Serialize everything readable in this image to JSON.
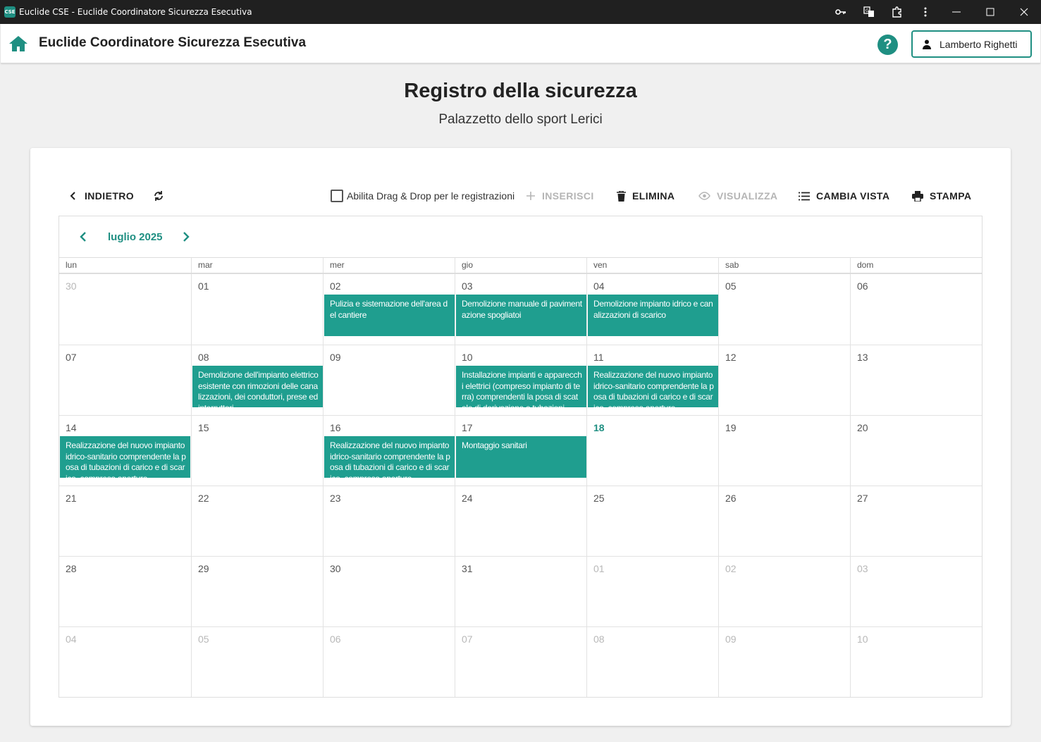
{
  "window": {
    "title": "Euclide CSE - Euclide Coordinatore Sicurezza Esecutiva",
    "logo_text": "CSE"
  },
  "appbar": {
    "title": "Euclide Coordinatore Sicurezza Esecutiva",
    "help_label": "?",
    "user_name": "Lamberto Righetti"
  },
  "page": {
    "title": "Registro della sicurezza",
    "subtitle": "Palazzetto dello sport Lerici"
  },
  "toolbar": {
    "back_label": "INDIETRO",
    "dragdrop_label": "Abilita Drag & Drop per le registrazioni",
    "dragdrop_checked": false,
    "insert_label": "INSERISCI",
    "delete_label": "ELIMINA",
    "view_label": "VISUALIZZA",
    "change_view_label": "CAMBIA VISTA",
    "print_label": "STAMPA"
  },
  "calendar": {
    "month_label": "luglio 2025",
    "weekdays": [
      "lun",
      "mar",
      "mer",
      "gio",
      "ven",
      "sab",
      "dom"
    ],
    "weeks": [
      [
        {
          "day": "30",
          "other": true
        },
        {
          "day": "01"
        },
        {
          "day": "02",
          "event": "Pulizia e sistemazione dell'area del cantiere"
        },
        {
          "day": "03",
          "event": "Demolizione manuale di pavimentazione spogliatoi"
        },
        {
          "day": "04",
          "event": "Demolizione impianto idrico e canalizzazioni di scarico"
        },
        {
          "day": "05"
        },
        {
          "day": "06"
        }
      ],
      [
        {
          "day": "07"
        },
        {
          "day": "08",
          "event": "Demolizione dell'impianto elettrico esistente con rimozioni delle canalizzazioni, dei conduttori, prese ed interruttori"
        },
        {
          "day": "09"
        },
        {
          "day": "10",
          "event": "Installazione impianti e apparecchi elettrici (compreso impianto di terra) comprendenti la posa di scatole di derivazione e tubazioni"
        },
        {
          "day": "11",
          "event": "Realizzazione del nuovo impianto idrico-sanitario comprendente la posa di tubazioni di carico e di scarico, compreso aperture"
        },
        {
          "day": "12"
        },
        {
          "day": "13"
        }
      ],
      [
        {
          "day": "14",
          "event": "Realizzazione del nuovo impianto idrico-sanitario comprendente la posa di tubazioni di carico e di scarico, compreso aperture"
        },
        {
          "day": "15"
        },
        {
          "day": "16",
          "event": "Realizzazione del nuovo impianto idrico-sanitario comprendente la posa di tubazioni di carico e di scarico, compreso aperture"
        },
        {
          "day": "17",
          "event": "Montaggio sanitari"
        },
        {
          "day": "18",
          "today": true
        },
        {
          "day": "19"
        },
        {
          "day": "20"
        }
      ],
      [
        {
          "day": "21"
        },
        {
          "day": "22"
        },
        {
          "day": "23"
        },
        {
          "day": "24"
        },
        {
          "day": "25"
        },
        {
          "day": "26"
        },
        {
          "day": "27"
        }
      ],
      [
        {
          "day": "28"
        },
        {
          "day": "29"
        },
        {
          "day": "30"
        },
        {
          "day": "31"
        },
        {
          "day": "01",
          "other": true
        },
        {
          "day": "02",
          "other": true
        },
        {
          "day": "03",
          "other": true
        }
      ],
      [
        {
          "day": "04",
          "other": true
        },
        {
          "day": "05",
          "other": true
        },
        {
          "day": "06",
          "other": true
        },
        {
          "day": "07",
          "other": true
        },
        {
          "day": "08",
          "other": true
        },
        {
          "day": "09",
          "other": true
        },
        {
          "day": "10",
          "other": true
        }
      ]
    ]
  },
  "colors": {
    "accent": "#1f8f82",
    "event_bg": "#1f9e8f"
  }
}
